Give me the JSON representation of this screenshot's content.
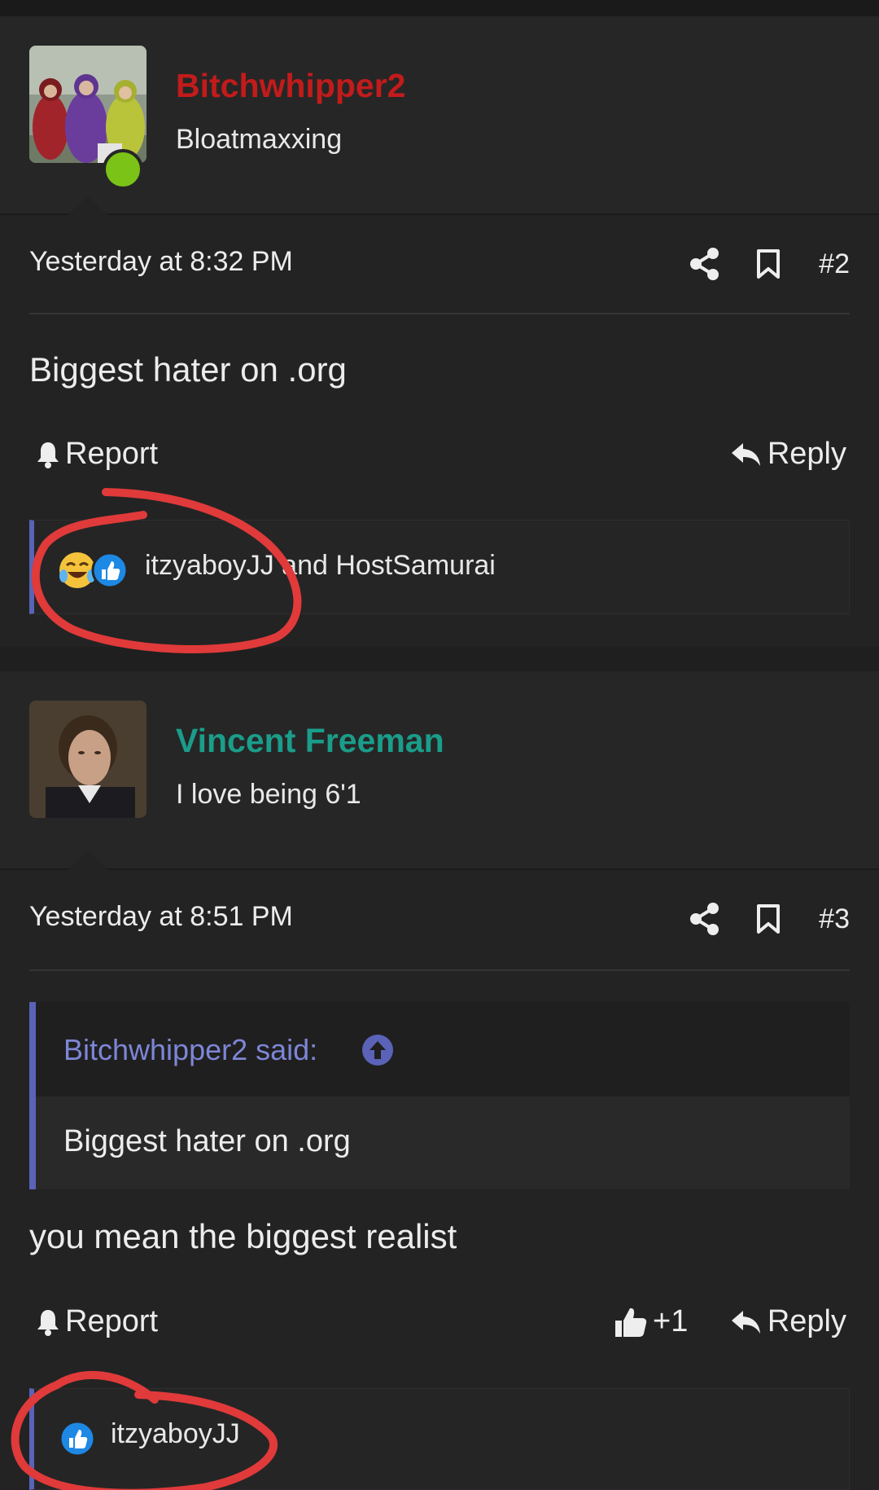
{
  "posts": [
    {
      "username": "Bitchwhipper2",
      "username_color": "#c21b1b",
      "user_title": "Bloatmaxxing",
      "online": true,
      "time": "Yesterday at 8:32 PM",
      "post_number": "#2",
      "message": "Biggest hater on .org",
      "report_label": "Report",
      "reply_label": "Reply",
      "reactions_text": "itzyaboyJJ and HostSamurai",
      "reaction_icons": [
        "laughing-crying-emoji-icon",
        "like-thumb-icon"
      ]
    },
    {
      "username": "Vincent Freeman",
      "username_color": "#1a9d8a",
      "user_title": "I love being 6'1",
      "time": "Yesterday at 8:51 PM",
      "post_number": "#3",
      "quote_author": "Bitchwhipper2 said:",
      "quote_text": "Biggest hater on .org",
      "message": "you mean the biggest realist",
      "report_label": "Report",
      "like_label": "+1",
      "reply_label": "Reply",
      "reactions_text": "itzyaboyJJ",
      "reaction_icons": [
        "like-thumb-icon"
      ]
    }
  ],
  "colors": {
    "background": "#232323",
    "accent": "#5a63b8",
    "annotation_circle": "#e03a3a"
  }
}
